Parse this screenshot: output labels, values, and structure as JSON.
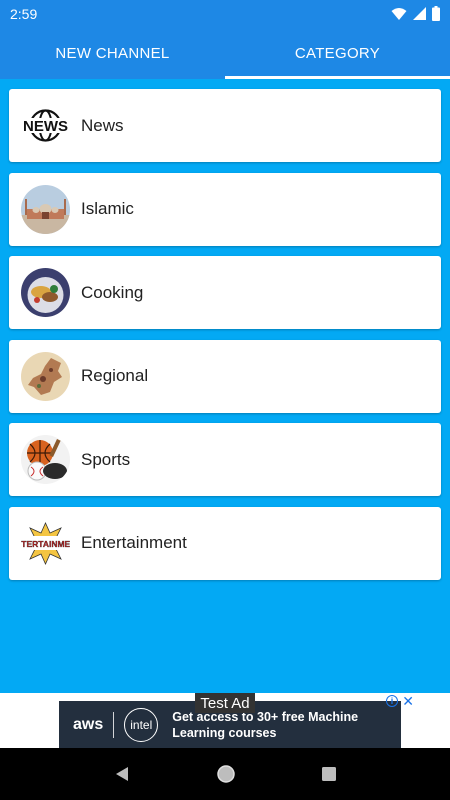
{
  "status_bar": {
    "time": "2:59"
  },
  "tabs": [
    {
      "label": "NEW CHANNEL",
      "active": false
    },
    {
      "label": "CATEGORY",
      "active": true
    }
  ],
  "categories": [
    {
      "label": "News",
      "icon": "news-logo-icon"
    },
    {
      "label": "Islamic",
      "icon": "mosque-icon"
    },
    {
      "label": "Cooking",
      "icon": "food-icon"
    },
    {
      "label": "Regional",
      "icon": "map-icon"
    },
    {
      "label": "Sports",
      "icon": "sports-balls-icon"
    },
    {
      "label": "Entertainment",
      "icon": "entertainment-icon"
    }
  ],
  "news_logo_text": "NEWS",
  "entertainment_logo_text": "ENTERTAINMENT",
  "ad": {
    "test_label": "Test Ad",
    "brand1": "aws",
    "brand2": "intel",
    "line1": "Get access to 30+ free Machine",
    "line2": "Learning courses",
    "info_glyph": "i",
    "close_glyph": "✕"
  },
  "colors": {
    "app_bar": "#1e88e5",
    "background": "#03a9f4",
    "ad_background": "#232f3e"
  }
}
